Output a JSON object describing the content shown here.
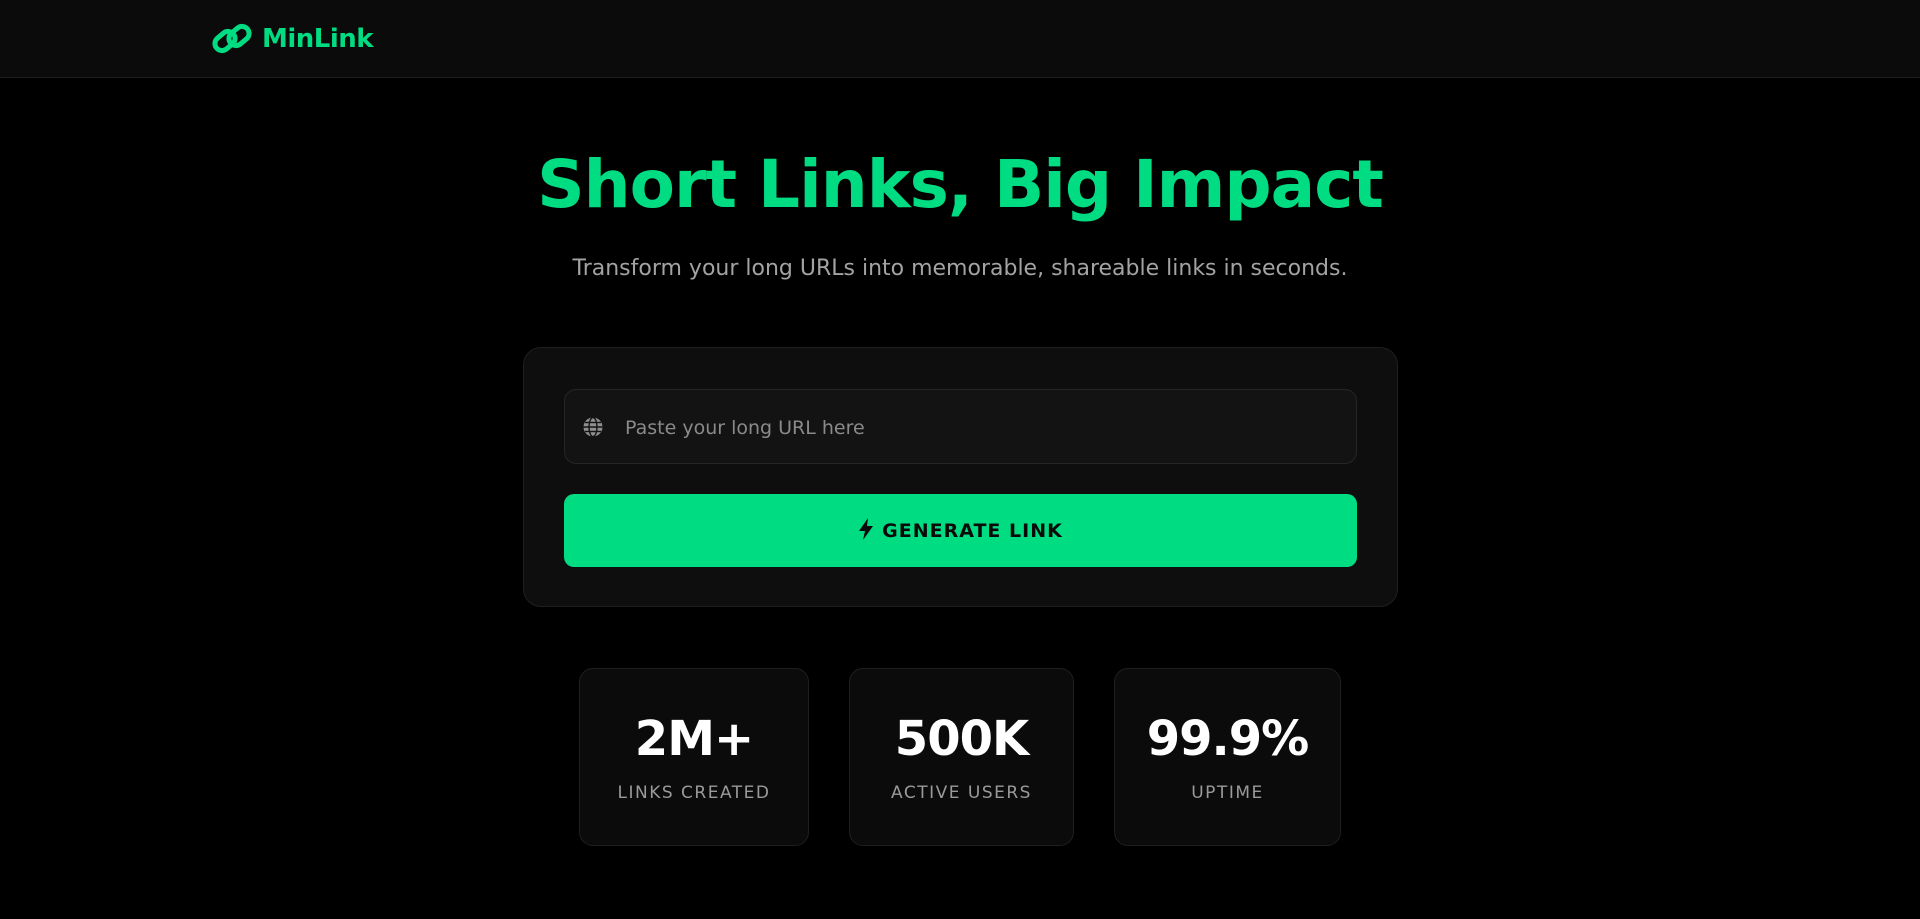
{
  "header": {
    "brand_name": "MinLink",
    "brand_icon": "link-icon",
    "accent_color": "#00dc82"
  },
  "hero": {
    "title": "Short Links, Big Impact",
    "subtitle": "Transform your long URLs into memorable, shareable links in seconds."
  },
  "shortener": {
    "input_icon": "globe-icon",
    "url_value": "",
    "url_placeholder": "Paste your long URL here",
    "button_icon": "lightning-icon",
    "button_label": "GENERATE LINK"
  },
  "stats": [
    {
      "value": "2M+",
      "label": "LINKS CREATED"
    },
    {
      "value": "500K",
      "label": "ACTIVE USERS"
    },
    {
      "value": "99.9%",
      "label": "UPTIME"
    }
  ]
}
